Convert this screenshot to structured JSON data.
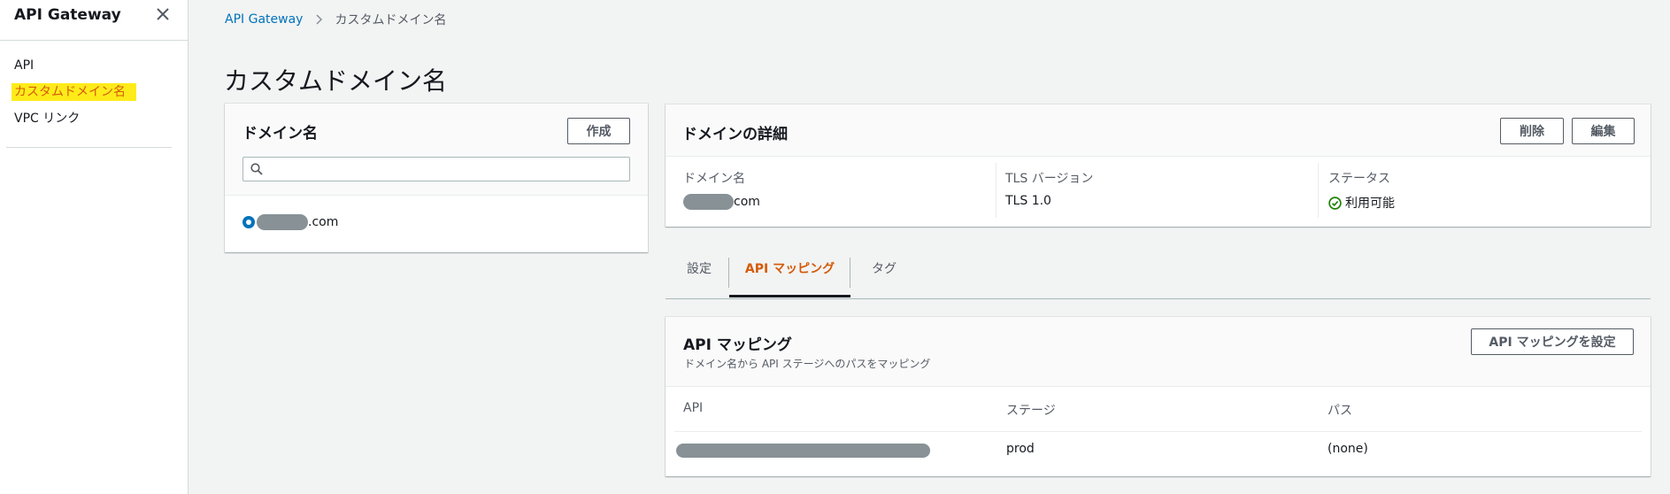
{
  "sidebar": {
    "title": "API Gateway",
    "items": [
      {
        "label": "API"
      },
      {
        "label": "カスタムドメイン名"
      },
      {
        "label": "VPC リンク"
      }
    ]
  },
  "breadcrumb": {
    "root": "API Gateway",
    "current": "カスタムドメイン名"
  },
  "page_title": "カスタムドメイン名",
  "domain_list": {
    "title": "ドメイン名",
    "create_label": "作成",
    "search_placeholder": "",
    "selected_domain_suffix": ".com"
  },
  "details": {
    "title": "ドメインの詳細",
    "delete_label": "削除",
    "edit_label": "編集",
    "domain_label": "ドメイン名",
    "domain_suffix": "com",
    "tls_label": "TLS バージョン",
    "tls_value": "TLS 1.0",
    "status_label": "ステータス",
    "status_value": "利用可能",
    "status_color": "#1d8102"
  },
  "tabs": [
    {
      "label": "設定"
    },
    {
      "label": "API マッピング",
      "active": true
    },
    {
      "label": "タグ"
    }
  ],
  "mapping": {
    "title": "API マッピング",
    "subtitle": "ドメイン名から API ステージへのパスをマッピング",
    "configure_label": "API マッピングを設定",
    "columns": [
      "API",
      "ステージ",
      "パス"
    ],
    "rows": [
      {
        "stage": "prod",
        "path": "(none)"
      }
    ]
  },
  "colors": {
    "accent": "#d45b07",
    "link": "#0073bb",
    "highlight": "#ffeb1a"
  }
}
